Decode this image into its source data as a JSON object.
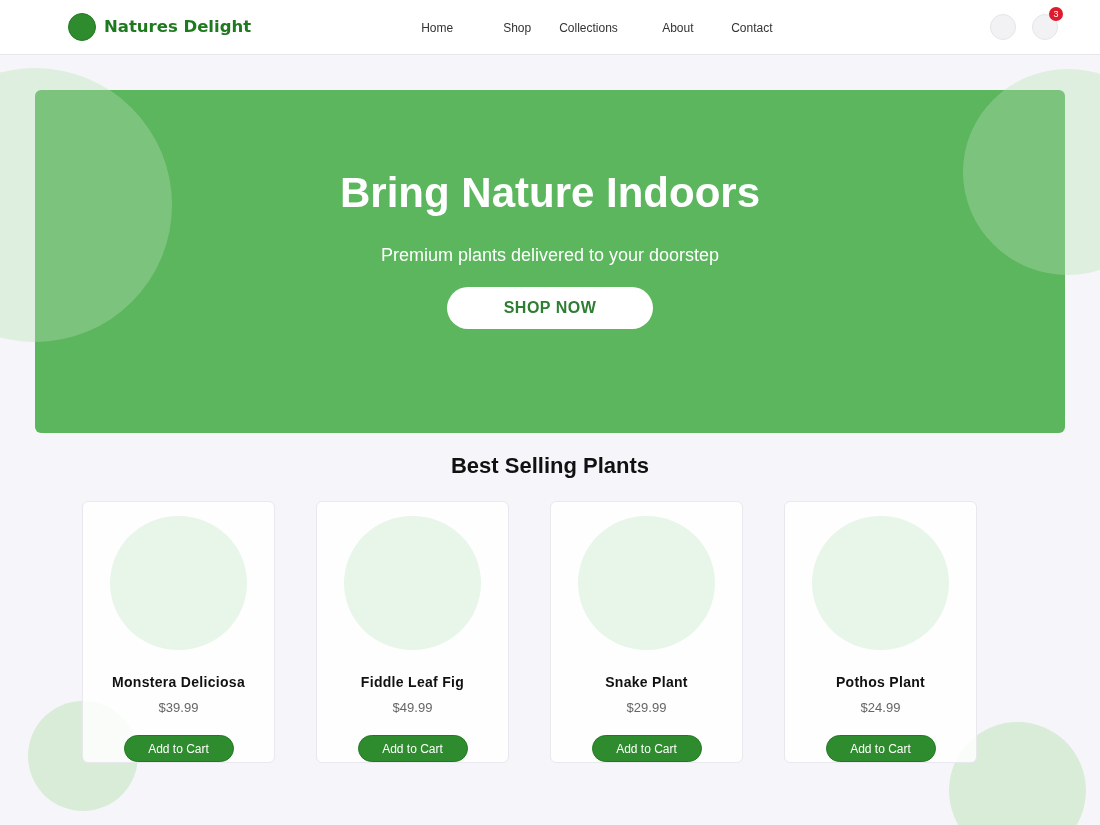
{
  "brand": {
    "name": "Natures Delight"
  },
  "nav": {
    "links": [
      "Home",
      "Shop",
      "Collections",
      "About",
      "Contact"
    ]
  },
  "cart": {
    "badge": "3"
  },
  "hero": {
    "title": "Bring Nature Indoors",
    "subtitle": "Premium plants delivered to your doorstep",
    "button": "SHOP NOW"
  },
  "section": {
    "title": "Best Selling Plants"
  },
  "products": [
    {
      "name": "Monstera Deliciosa",
      "price": "$39.99",
      "button": "Add to Cart"
    },
    {
      "name": "Fiddle Leaf Fig",
      "price": "$49.99",
      "button": "Add to Cart"
    },
    {
      "name": "Snake Plant",
      "price": "$29.99",
      "button": "Add to Cart"
    },
    {
      "name": "Pothos Plant",
      "price": "$24.99",
      "button": "Add to Cart"
    }
  ]
}
